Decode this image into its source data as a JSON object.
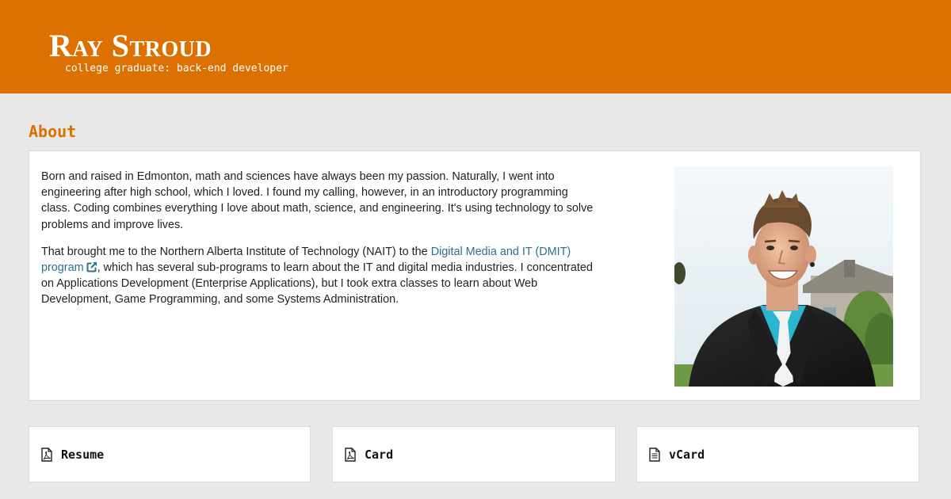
{
  "header": {
    "title": "Ray Stroud",
    "tagline": "college graduate: back-end developer"
  },
  "about": {
    "heading": "About",
    "paragraph1": "Born and raised in Edmonton, math and sciences have always been my passion. Naturally, I went into engineering after high school, which I loved. I found my calling, however, in an introductory programming class. Coding combines everything I love about math, science, and engineering. It's using technology to solve problems and improve lives.",
    "paragraph2_before": "That brought me to the Northern Alberta Institute of Technology (NAIT) to the ",
    "paragraph2_link": "Digital Media and IT (DMIT) program",
    "paragraph2_after": ", which has several sub-programs to learn about the IT and digital media industries. I concentrated on Applications Development (Enterprise Applications), but I took extra classes to learn about Web Development, Game Programming, and some Systems Administration.",
    "link_icon": "external-link-icon",
    "photo_icon": "profile-photo"
  },
  "downloads": [
    {
      "label": "Resume",
      "icon": "pdf-file-icon"
    },
    {
      "label": "Card",
      "icon": "pdf-file-icon"
    },
    {
      "label": "vCard",
      "icon": "text-file-icon"
    }
  ],
  "colors": {
    "accent": "#dc7000",
    "page_background": "#e8e8e8",
    "link": "#2f6f8f",
    "panel": "#ffffff"
  }
}
